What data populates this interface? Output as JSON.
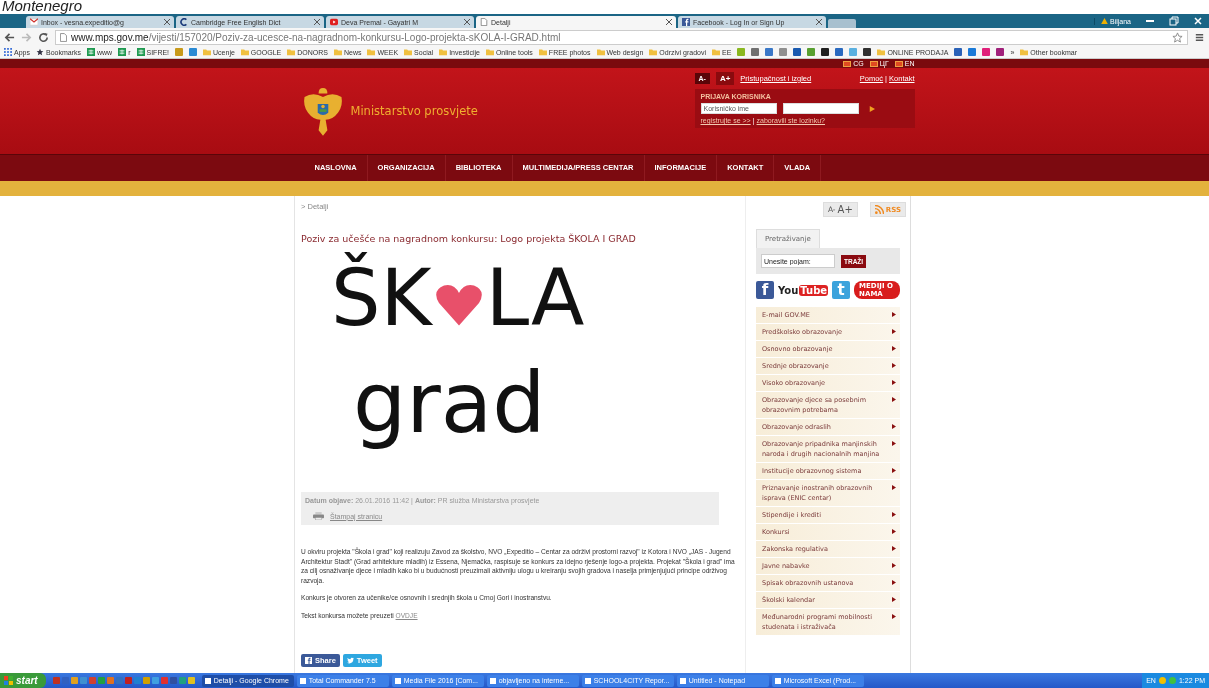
{
  "caption": "Montenegro",
  "browser": {
    "tabs": [
      {
        "kind": "mail",
        "label": "Inbox - vesna.expeditio@g",
        "selected": false
      },
      {
        "kind": "dictionary",
        "label": "Cambridge Free English Dict",
        "selected": false
      },
      {
        "kind": "video",
        "label": "Deva Premal - Gayatri M",
        "selected": false
      },
      {
        "kind": "page",
        "label": "Detalji",
        "selected": true
      },
      {
        "kind": "facebook",
        "label": "Facebook - Log In or Sign Up",
        "selected": false
      }
    ],
    "profile": "Biljana",
    "url_host": "www.mps.gov.me",
    "url_path": "/vijesti/157020/Poziv-za-ucesce-na-nagradnom-konkursu-Logo-projekta-sKOLA-I-GRAD.html",
    "bookmarks": [
      {
        "kind": "apps",
        "label": "Apps"
      },
      {
        "kind": "star",
        "label": "Bookmarks"
      },
      {
        "kind": "sheet",
        "label": "www"
      },
      {
        "kind": "sheet",
        "label": "r"
      },
      {
        "kind": "sheet",
        "label": "SIFRE!"
      },
      {
        "kind": "favicon",
        "color": "#c89a1a"
      },
      {
        "kind": "favicon",
        "color": "#2a8ad4"
      },
      {
        "kind": "folder",
        "label": "Ucenje"
      },
      {
        "kind": "folder",
        "label": "GOOGLE"
      },
      {
        "kind": "folder",
        "label": "DONORS"
      },
      {
        "kind": "folder",
        "label": "News"
      },
      {
        "kind": "folder",
        "label": "WEEK"
      },
      {
        "kind": "folder",
        "label": "Social"
      },
      {
        "kind": "folder",
        "label": "Investicije"
      },
      {
        "kind": "folder",
        "label": "Online tools"
      },
      {
        "kind": "folder",
        "label": "FREE photos"
      },
      {
        "kind": "folder",
        "label": "Web design"
      },
      {
        "kind": "folder",
        "label": "Odrzivi gradovi"
      },
      {
        "kind": "folder",
        "label": "EE"
      },
      {
        "kind": "favicon",
        "color": "#8ab820"
      },
      {
        "kind": "favicon",
        "color": "#707070"
      },
      {
        "kind": "favicon",
        "color": "#3a78c8"
      },
      {
        "kind": "favicon",
        "color": "#909090"
      },
      {
        "kind": "favicon",
        "color": "#1a5ab0"
      },
      {
        "kind": "favicon",
        "color": "#58a030"
      },
      {
        "kind": "favicon",
        "color": "#202020"
      },
      {
        "kind": "favicon",
        "color": "#2a6ac0"
      },
      {
        "kind": "favicon",
        "color": "#5ab0e0"
      },
      {
        "kind": "favicon",
        "color": "#303030"
      },
      {
        "kind": "folder",
        "label": "ONLINE PRODAJA"
      },
      {
        "kind": "favicon",
        "color": "#2a62b8"
      },
      {
        "kind": "favicon",
        "color": "#1a7ad8"
      },
      {
        "kind": "favicon",
        "color": "#e0207a"
      },
      {
        "kind": "favicon",
        "color": "#a0207a"
      },
      {
        "kind": "more",
        "label": "»"
      },
      {
        "kind": "folder",
        "label": "Other bookmar"
      }
    ]
  },
  "header": {
    "languages": [
      "CG",
      "ЦГ",
      "EN"
    ],
    "font_smaller": "A-",
    "font_larger": "A+",
    "links": [
      "Pristupačnost i izgled",
      "Pomoć",
      "Kontakt"
    ],
    "link_separator": "|",
    "site_name": "Ministarstvo prosvjete",
    "login": {
      "title": "PRIJAVA KORISNIKA",
      "username_placeholder": "Korisničko ime",
      "register": "registrujte se >>",
      "separator": "|",
      "forgot": "zaboravili ste lozinku?"
    },
    "nav": [
      "NASLOVNA",
      "ORGANIZACIJA",
      "BIBLIOTEKA",
      "MULTIMEDIJA/PRESS CENTAR",
      "INFORMACIJE",
      "KONTAKT",
      "VLADA"
    ]
  },
  "article": {
    "breadcrumb": "> Detalji",
    "title": "Poziv za učešće na nagradnom konkursu: Logo projekta ŠKOLA I GRAD",
    "logo": {
      "top_left": "ŠK",
      "top_right": "LA",
      "bottom": "grad"
    },
    "meta": "**Datum objave:** 26.01.2016 11:42 | **Autor:** PR služba Ministarstva prosvjete",
    "print": "Štampaj stranicu",
    "paragraphs": [
      "U okviru projekta \"Škola i grad\" koji realizuju Zavod za školstvo, NVO „Expeditio – Centar za održivi prostorni razvoj\" iz Kotora i NVO „JAS - Jugend Architektur Stadt\" (Grad arhitekture mladih) iz Essena, Njemačka, raspisuje se konkurs za idejno rješenje logo-a projekta. Projekat \"Škola i grad\" ima za cilj osnaživanje djece i mladih kako bi u budućnosti preuzimali aktivniju ulogu u kreiranju svojih gradova i naselja primjenjujući principe održivog razvoja.",
      "Konkurs je otvoren za učenike/ce osnovnih i srednjih škola u Crnoj Gori i inostranstvu."
    ],
    "download_text": "Tekst konkursa možete preuzeti",
    "download_link": "OVDJE",
    "share": "Share",
    "tweet": "Tweet"
  },
  "sidebar": {
    "font_smaller": "A-",
    "font_larger": "A+",
    "rss": "RSS",
    "search_tab": "Pretraživanje",
    "search_placeholder": "Unesite pojam:",
    "search_button": "TRAŽI",
    "social": [
      {
        "kind": "facebook",
        "label": "f"
      },
      {
        "kind": "youtube",
        "label": "You",
        "label2": "Tube"
      },
      {
        "kind": "twitter",
        "label": "t"
      },
      {
        "kind": "media",
        "label": "MEDIJI O NAMA"
      }
    ],
    "menu": [
      "E-mail GOV.ME",
      "Predškolsko obrazovanje",
      "Osnovno obrazovanje",
      "Srednje obrazovanje",
      "Visoko obrazovanje",
      "Obrazovanje djece sa posebnim obrazovnim potrebama",
      "Obrazovanje odraslih",
      "Obrazovanje pripadnika manjinskih naroda i drugih nacionalnih manjina",
      "Institucije obrazovnog sistema",
      "Priznavanje inostranih obrazovnih isprava (ENIC centar)",
      "Stipendije i krediti",
      "Konkursi",
      "Zakonska regulativa",
      "Javne nabavke",
      "Spisak obrazovnih ustanova",
      "Školski kalendar",
      "Međunarodni programi mobilnosti studenata i istraživača"
    ]
  },
  "taskbar": {
    "start": "start",
    "quick_launch": [
      {
        "color": "#c03020"
      },
      {
        "color": "#3060c0"
      },
      {
        "color": "#e0a020"
      },
      {
        "color": "#4090d0"
      },
      {
        "color": "#d04030"
      },
      {
        "color": "#20a040"
      },
      {
        "color": "#e07020"
      },
      {
        "color": "#3070c0"
      },
      {
        "color": "#c02020"
      },
      {
        "color": "#2080d0"
      },
      {
        "color": "#d0a000"
      },
      {
        "color": "#40a0e0"
      },
      {
        "color": "#e03030"
      },
      {
        "color": "#3050a0"
      },
      {
        "color": "#20a080"
      },
      {
        "color": "#e0c020"
      }
    ],
    "tasks": [
      {
        "label": "Detalji - Google Chrome",
        "selected": true
      },
      {
        "label": "Total Commander 7.5",
        "selected": false
      },
      {
        "label": "Media File 2016 [Com...",
        "selected": false
      },
      {
        "label": "objavljeno na interne...",
        "selected": false
      },
      {
        "label": "SCHOOL4CITY Repor...",
        "selected": false
      },
      {
        "label": "Untitled - Notepad",
        "selected": false
      },
      {
        "label": "Microsoft Excel (Prod...",
        "selected": false
      }
    ],
    "language": "EN",
    "time": "1:22 PM"
  }
}
